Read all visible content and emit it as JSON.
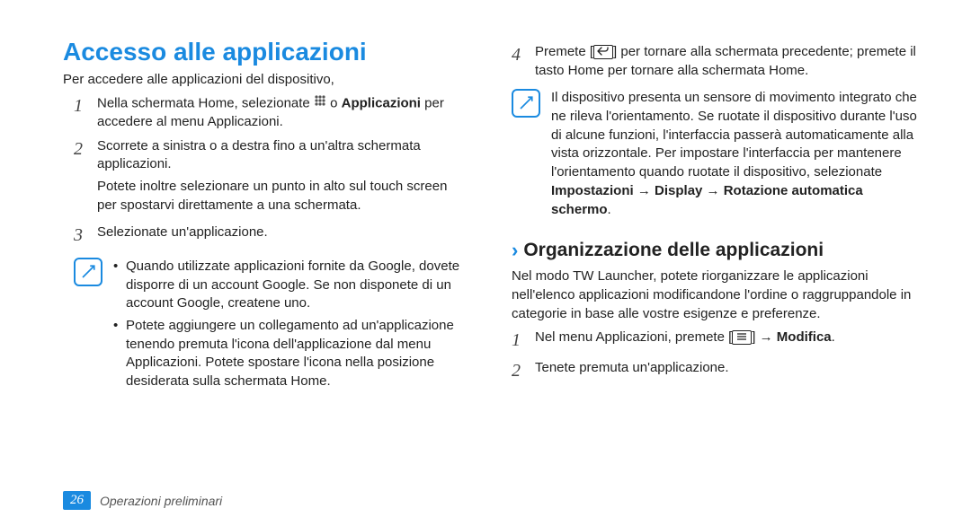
{
  "title": "Accesso alle applicazioni",
  "intro": "Per accedere alle applicazioni del dispositivo,",
  "steps_left": [
    {
      "num": "1",
      "html": "Nella schermata Home, selezionate {grid} o <b>Applicazioni</b> per accedere al menu Applicazioni."
    },
    {
      "num": "2",
      "html": "Scorrete a sinistra o a destra fino a un'altra schermata applicazioni.",
      "extra": "Potete inoltre selezionare un punto in alto sul touch screen per spostarvi direttamente a una schermata."
    },
    {
      "num": "3",
      "html": "Selezionate un'applicazione."
    }
  ],
  "note_left": [
    "Quando utilizzate applicazioni fornite da Google, dovete disporre di un account Google. Se non disponete di un account Google, createne uno.",
    "Potete aggiungere un collegamento ad un'applicazione tenendo premuta l'icona dell'applicazione dal menu Applicazioni. Potete spostare l'icona nella posizione desiderata sulla schermata Home."
  ],
  "step_right": {
    "num": "4",
    "html": "Premete [{back}] per tornare alla schermata precedente; premete il tasto Home per tornare alla schermata Home."
  },
  "note_right": "Il dispositivo presenta un sensore di movimento integrato che ne rileva l'orientamento. Se ruotate il dispositivo durante l'uso di alcune funzioni, l'interfaccia passerà automaticamente alla vista orizzontale. Per impostare l'interfaccia per mantenere l'orientamento quando ruotate il dispositivo, selezionate <b>Impostazioni</b> → <b>Display</b> → <b>Rotazione automatica schermo</b>.",
  "subheading": "Organizzazione delle applicazioni",
  "sub_body": "Nel modo TW Launcher, potete riorganizzare le applicazioni nell'elenco applicazioni modificandone l'ordine o raggruppandole in categorie in base alle vostre esigenze e preferenze.",
  "sub_steps": [
    {
      "num": "1",
      "html": "Nel menu Applicazioni, premete [{menu}] → <b>Modifica</b>."
    },
    {
      "num": "2",
      "html": "Tenete premuta un'applicazione."
    }
  ],
  "footer": {
    "page": "26",
    "section": "Operazioni preliminari"
  }
}
